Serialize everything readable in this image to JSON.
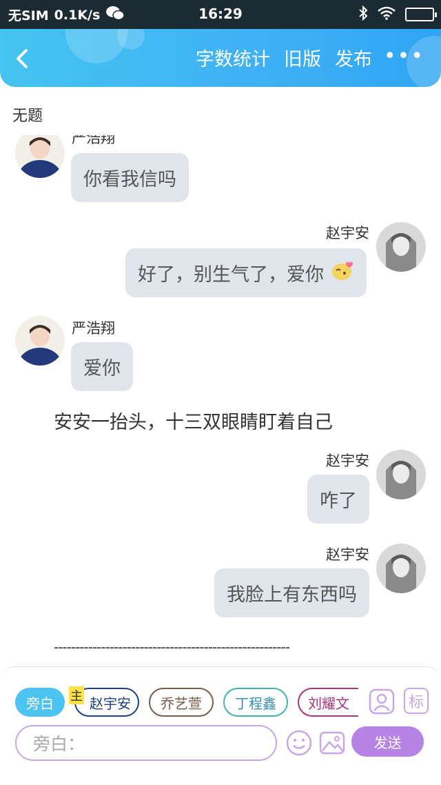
{
  "status_bar": {
    "carrier": "无SIM",
    "speed": "0.1K/s",
    "time": "16:29"
  },
  "header": {
    "actions": [
      "字数统计",
      "旧版",
      "发布"
    ],
    "more": "•••"
  },
  "document": {
    "title": "无题"
  },
  "chat": {
    "messages": [
      {
        "speaker": "严浩翔",
        "text": "你看我信吗"
      },
      {
        "speaker": "赵宇安",
        "text": "好了，别生气了，爱你"
      },
      {
        "speaker": "严浩翔",
        "text": "爱你"
      },
      {
        "speaker": "",
        "text": "安安一抬头，十三双眼睛盯着自己"
      },
      {
        "speaker": "赵宇安",
        "text": "咋了"
      },
      {
        "speaker": "赵宇安",
        "text": "我脸上有东西吗"
      }
    ],
    "divider": "-------------------------------------------------------"
  },
  "composer": {
    "chips": [
      "旁白",
      "赵宇安",
      "乔艺萱",
      "丁程鑫",
      "刘耀文"
    ],
    "main_badge": "主",
    "tag_button": "标",
    "input_placeholder": "旁白：",
    "send_label": "发送"
  },
  "colors": {
    "header": "#3fb0f5",
    "bubble": "#dfe5ea",
    "send": "#b684e6",
    "chip_active": "#4cc3f2"
  }
}
